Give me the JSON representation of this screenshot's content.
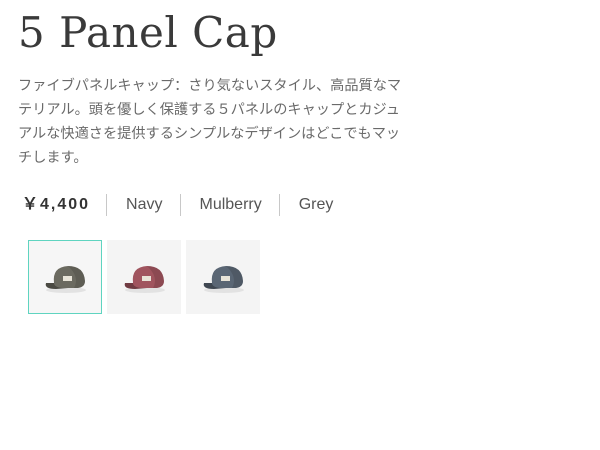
{
  "product": {
    "title": "5 Panel Cap",
    "description": "ファイブパネルキャップ：さり気ないスタイル、高品質なマテリアル。頭を優しく保護する５パネルのキャップとカジュアルな快適さを提供するシンプルなデザインはどこでもマッチします。",
    "price": "￥4,400",
    "colors": [
      "Navy",
      "Mulberry",
      "Grey"
    ]
  },
  "thumbnails": [
    {
      "name": "cap-thumbnail-olive",
      "color": "#6b6a60",
      "selected": true
    },
    {
      "name": "cap-thumbnail-mulberry",
      "color": "#a0545e",
      "selected": false
    },
    {
      "name": "cap-thumbnail-blue-grey",
      "color": "#5a6674",
      "selected": false
    }
  ],
  "accent_color": "#5fd4c0"
}
